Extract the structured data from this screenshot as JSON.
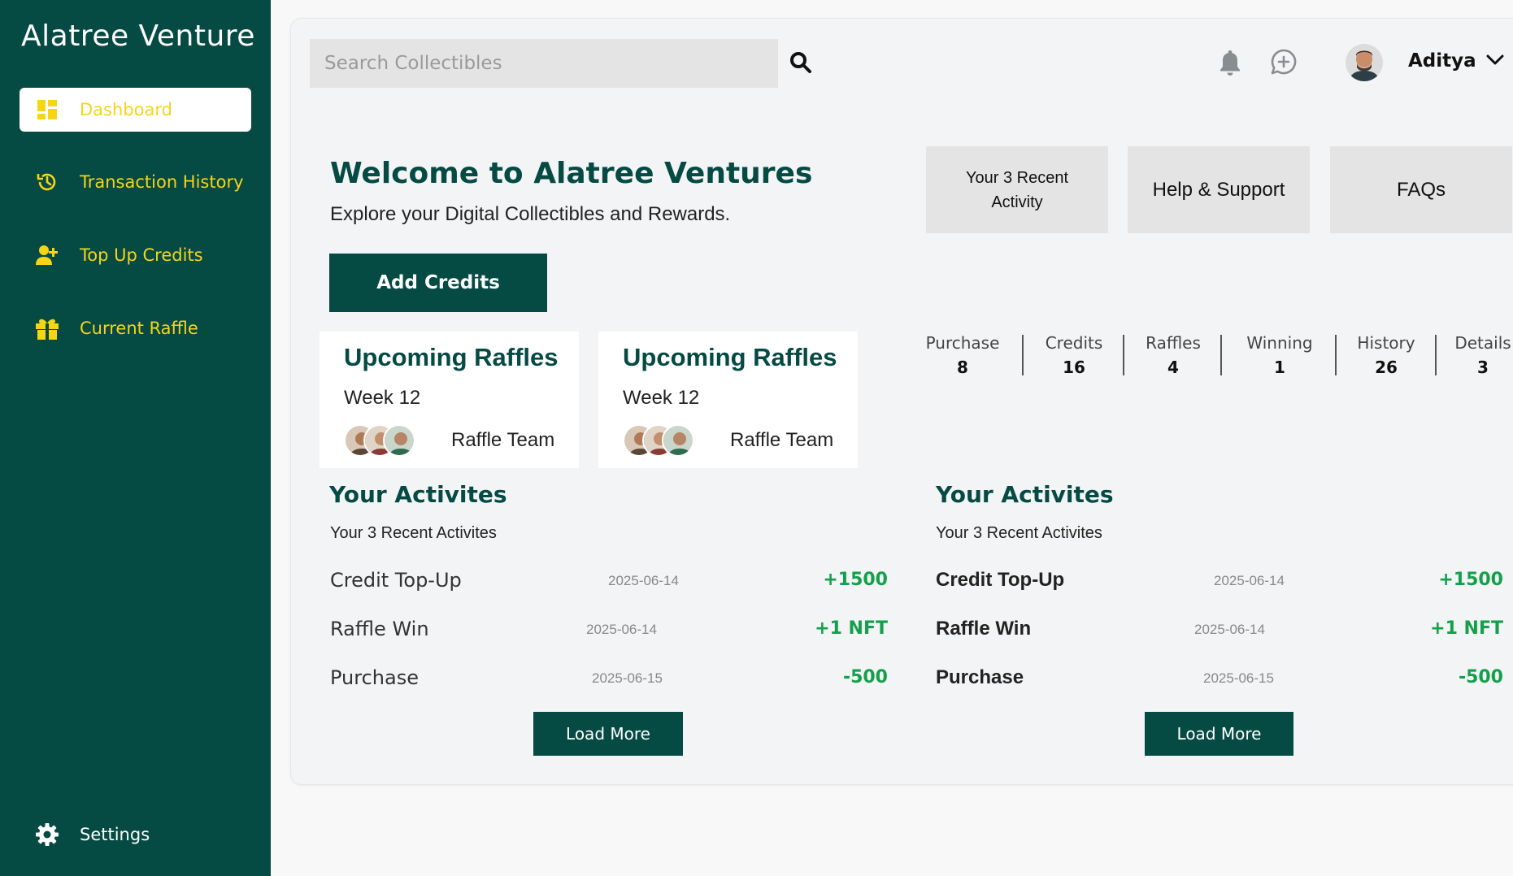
{
  "app": {
    "brand": "Alatree Venture"
  },
  "sidebar": {
    "items": [
      {
        "label": "Dashboard",
        "icon": "dashboard-icon",
        "active": true
      },
      {
        "label": "Transaction History",
        "icon": "history-icon"
      },
      {
        "label": "Top Up Credits",
        "icon": "add-user-icon"
      },
      {
        "label": "Current Raffle",
        "icon": "gift-icon"
      }
    ],
    "settings_label": "Settings"
  },
  "header": {
    "search_placeholder": "Search Collectibles",
    "user_name": "Aditya"
  },
  "welcome": {
    "title": "Welcome to Alatree Ventures",
    "subtitle": "Explore your Digital Collectibles and Rewards.",
    "add_credits_label": "Add Credits"
  },
  "tiles": [
    {
      "label": "Your 3 Recent Activity"
    },
    {
      "label": "Help & Support"
    },
    {
      "label": "FAQs"
    }
  ],
  "raffles": [
    {
      "title": "Upcoming Raffles",
      "week": "Week 12",
      "team": "Raffle Team"
    },
    {
      "title": "Upcoming Raffles",
      "week": "Week 12",
      "team": "Raffle Team"
    }
  ],
  "stats": [
    {
      "label": "Purchase",
      "value": "8"
    },
    {
      "label": "Credits",
      "value": "16"
    },
    {
      "label": "Raffles",
      "value": "4"
    },
    {
      "label": "Winning",
      "value": "1"
    },
    {
      "label": "History",
      "value": "26"
    },
    {
      "label": "Details",
      "value": "3"
    }
  ],
  "activities": [
    {
      "title": "Your Activites",
      "subtitle": "Your 3 Recent Activites",
      "rows": [
        {
          "name": "Credit Top-Up",
          "date": "2025-06-14",
          "amount": "+1500"
        },
        {
          "name": "Raffle Win",
          "date": "2025-06-14",
          "amount": "+1 NFT"
        },
        {
          "name": "Purchase",
          "date": "2025-06-15",
          "amount": "-500"
        }
      ],
      "load_more": "Load More"
    },
    {
      "title": "Your Activites",
      "subtitle": "Your 3 Recent Activites",
      "rows": [
        {
          "name": "Credit Top-Up",
          "date": "2025-06-14",
          "amount": "+1500"
        },
        {
          "name": "Raffle Win",
          "date": "2025-06-14",
          "amount": "+1 NFT"
        },
        {
          "name": "Purchase",
          "date": "2025-06-15",
          "amount": "-500"
        }
      ],
      "load_more": "Load More"
    }
  ],
  "colors": {
    "primary": "#064a44",
    "accent": "#f5d516",
    "positive": "#14a04a"
  }
}
